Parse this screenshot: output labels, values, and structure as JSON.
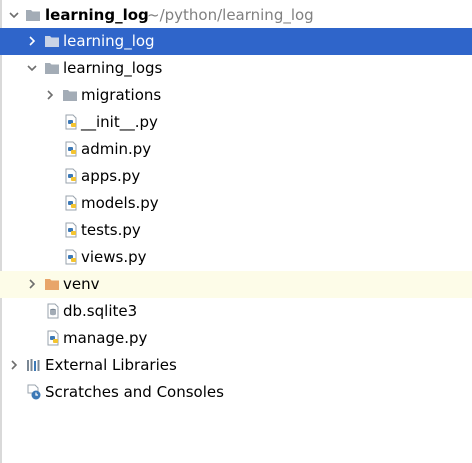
{
  "colors": {
    "selection": "#2f65ca",
    "excluded_row": "#fdfce8",
    "folder": "#a3acb6",
    "venv_folder": "#e8a56a",
    "python_blue": "#3d79b6",
    "python_yellow": "#f4c430",
    "muted_text": "#808080"
  },
  "tree": {
    "root": {
      "label": "learning_log",
      "path": "~/python/learning_log",
      "icon": "folder-icon"
    },
    "items": [
      {
        "label": "learning_log",
        "icon": "folder-icon",
        "state": "collapsed",
        "selected": true
      },
      {
        "label": "learning_logs",
        "icon": "folder-icon",
        "state": "expanded"
      },
      {
        "label": "migrations",
        "icon": "folder-icon",
        "state": "collapsed"
      },
      {
        "label": "__init__.py",
        "icon": "python-file-icon"
      },
      {
        "label": "admin.py",
        "icon": "python-file-icon"
      },
      {
        "label": "apps.py",
        "icon": "python-file-icon"
      },
      {
        "label": "models.py",
        "icon": "python-file-icon"
      },
      {
        "label": "tests.py",
        "icon": "python-file-icon"
      },
      {
        "label": "views.py",
        "icon": "python-file-icon"
      },
      {
        "label": "venv",
        "icon": "excluded-folder-icon",
        "state": "collapsed",
        "excluded": true
      },
      {
        "label": "db.sqlite3",
        "icon": "database-file-icon"
      },
      {
        "label": "manage.py",
        "icon": "python-file-icon"
      },
      {
        "label": "External Libraries",
        "icon": "libraries-icon",
        "state": "collapsed"
      },
      {
        "label": "Scratches and Consoles",
        "icon": "scratches-icon"
      }
    ]
  }
}
